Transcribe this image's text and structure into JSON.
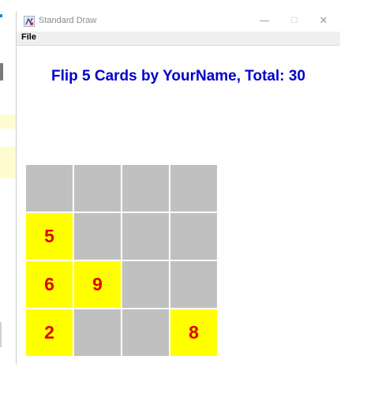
{
  "window": {
    "title": "Standard Draw",
    "minimize_glyph": "—",
    "maximize_glyph": "☐",
    "close_glyph": "✕",
    "app_icon": "java-duke-icon"
  },
  "menubar": {
    "file_label": "File"
  },
  "game": {
    "heading": "Flip 5 Cards by YourName, Total: 30",
    "grid_rows": 4,
    "grid_cols": 4,
    "cards": [
      {
        "row": 0,
        "col": 0,
        "flipped": false,
        "value": ""
      },
      {
        "row": 0,
        "col": 1,
        "flipped": false,
        "value": ""
      },
      {
        "row": 0,
        "col": 2,
        "flipped": false,
        "value": ""
      },
      {
        "row": 0,
        "col": 3,
        "flipped": false,
        "value": ""
      },
      {
        "row": 1,
        "col": 0,
        "flipped": true,
        "value": "5"
      },
      {
        "row": 1,
        "col": 1,
        "flipped": false,
        "value": ""
      },
      {
        "row": 1,
        "col": 2,
        "flipped": false,
        "value": ""
      },
      {
        "row": 1,
        "col": 3,
        "flipped": false,
        "value": ""
      },
      {
        "row": 2,
        "col": 0,
        "flipped": true,
        "value": "6"
      },
      {
        "row": 2,
        "col": 1,
        "flipped": true,
        "value": "9"
      },
      {
        "row": 2,
        "col": 2,
        "flipped": false,
        "value": ""
      },
      {
        "row": 2,
        "col": 3,
        "flipped": false,
        "value": ""
      },
      {
        "row": 3,
        "col": 0,
        "flipped": true,
        "value": "2"
      },
      {
        "row": 3,
        "col": 1,
        "flipped": false,
        "value": ""
      },
      {
        "row": 3,
        "col": 2,
        "flipped": false,
        "value": ""
      },
      {
        "row": 3,
        "col": 3,
        "flipped": true,
        "value": "8"
      }
    ],
    "colors": {
      "face_down": "#c0c0c0",
      "face_up": "#ffff00",
      "number": "#e00000",
      "heading": "#0000cc"
    }
  }
}
